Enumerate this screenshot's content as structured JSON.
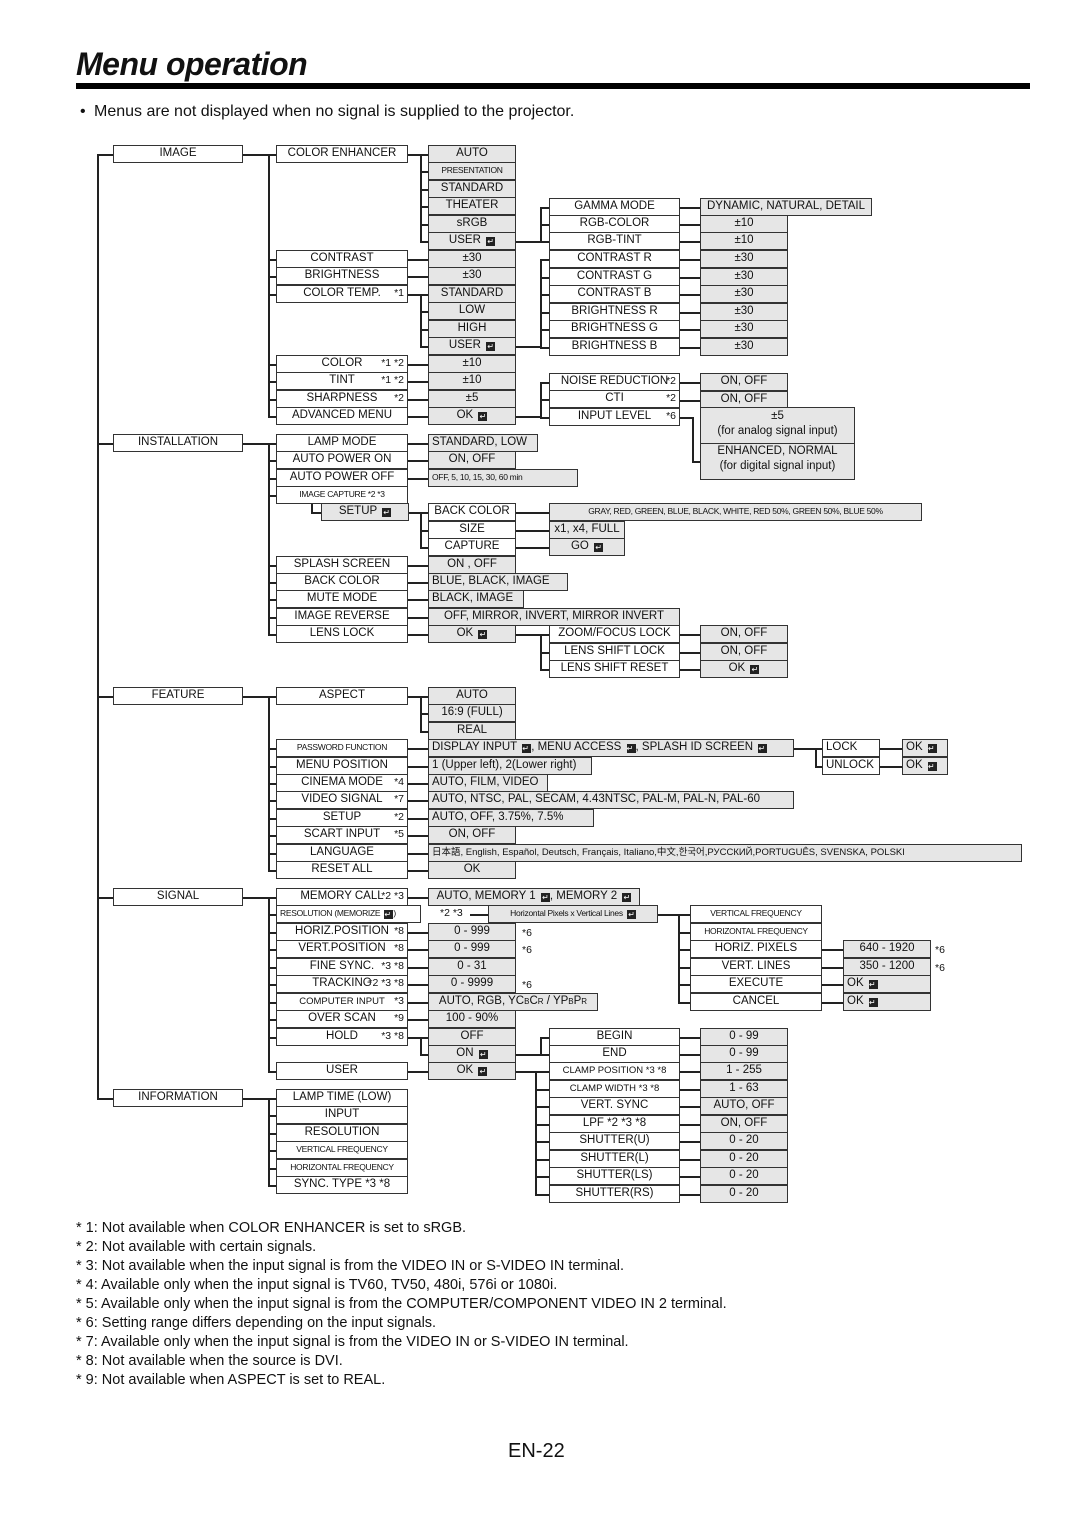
{
  "page": {
    "title": "Menu operation",
    "bullet": "Menus are not displayed when no signal is supplied to the projector.",
    "page_number": "EN-22"
  },
  "menu": {
    "top": [
      "IMAGE",
      "INSTALLATION",
      "FEATURE",
      "SIGNAL",
      "INFORMATION"
    ],
    "image": {
      "items": [
        "COLOR ENHANCER",
        "CONTRAST",
        "BRIGHTNESS",
        "COLOR TEMP.",
        "COLOR",
        "TINT",
        "SHARPNESS",
        "ADVANCED MENU"
      ],
      "notes": [
        "",
        "",
        "",
        "*1",
        "*1 *2",
        "*1 *2",
        "*2",
        ""
      ],
      "color_enhancer_options": [
        "AUTO",
        "PRESENTATION",
        "STANDARD",
        "THEATER",
        "sRGB",
        "USER"
      ],
      "contrast_value": "±30",
      "brightness_value": "±30",
      "color_temp_options": [
        "STANDARD",
        "LOW",
        "HIGH",
        "USER"
      ],
      "color_value": "±10",
      "tint_value": "±10",
      "sharpness_value": "±5",
      "advanced_value": "OK",
      "user_enhancer_items": [
        "GAMMA MODE",
        "RGB-COLOR",
        "RGB-TINT"
      ],
      "user_enhancer_values": [
        "DYNAMIC, NATURAL, DETAIL",
        "±10",
        "±10"
      ],
      "user_temp_items": [
        "CONTRAST R",
        "CONTRAST G",
        "CONTRAST B",
        "BRIGHTNESS R",
        "BRIGHTNESS G",
        "BRIGHTNESS B"
      ],
      "user_temp_values": [
        "±30",
        "±30",
        "±30",
        "±30",
        "±30",
        "±30"
      ],
      "advanced_items": [
        "NOISE REDUCTION",
        "CTI",
        "INPUT LEVEL"
      ],
      "advanced_notes": [
        "*2",
        "*2",
        "*6"
      ],
      "advanced_values": [
        "ON, OFF",
        "ON, OFF"
      ],
      "input_level_analog": [
        "±5",
        "(for analog signal input)"
      ],
      "input_level_digital": [
        "ENHANCED, NORMAL",
        "(for digital signal input)"
      ]
    },
    "installation": {
      "items": [
        "LAMP MODE",
        "AUTO POWER ON",
        "AUTO POWER OFF",
        "IMAGE CAPTURE  *2 *3",
        "SETUP",
        "SPLASH SCREEN",
        "BACK COLOR",
        "MUTE MODE",
        "IMAGE REVERSE",
        "LENS LOCK"
      ],
      "values": [
        "STANDARD, LOW",
        "ON, OFF",
        "OFF,  5,  10,  15,  30,  60 min"
      ],
      "setup_items": [
        "BACK COLOR",
        "SIZE",
        "CAPTURE"
      ],
      "setup_values": [
        "GRAY, RED, GREEN, BLUE, BLACK, WHITE, RED 50%, GREEN 50%, BLUE 50%",
        "x1, x4, FULL",
        "GO"
      ],
      "splash_value": "ON , OFF",
      "back_color_value": "BLUE, BLACK, IMAGE",
      "mute_value": "BLACK, IMAGE",
      "reverse_value": "OFF, MIRROR, INVERT, MIRROR INVERT",
      "lens_lock_value": "OK",
      "lens_items": [
        "ZOOM/FOCUS LOCK",
        "LENS SHIFT LOCK",
        "LENS SHIFT RESET"
      ],
      "lens_values": [
        "ON, OFF",
        "ON, OFF",
        "OK"
      ]
    },
    "feature": {
      "items": [
        "ASPECT",
        "PASSWORD FUNCTION",
        "MENU POSITION",
        "CINEMA MODE",
        "VIDEO SIGNAL",
        "SETUP",
        "SCART INPUT",
        "LANGUAGE",
        "RESET ALL"
      ],
      "notes": [
        "",
        "",
        "",
        "*4",
        "*7",
        "*2",
        "*5",
        "",
        ""
      ],
      "aspect_options": [
        "AUTO",
        "16:9 (FULL)",
        "REAL"
      ],
      "values": [
        "DISPLAY INPUT ↵, MENU ACCESS ↵, SPLASH ID SCREEN ↵",
        "1 (Upper left), 2(Lower right)",
        "AUTO, FILM, VIDEO",
        "AUTO, NTSC, PAL, SECAM, 4.43NTSC, PAL-M, PAL-N, PAL-60",
        "AUTO, OFF, 3.75%, 7.5%",
        "ON, OFF",
        "日本語, English, Español, Deutsch, Français, Italiano,中文,한국어,РУССКИЙ,PORTUGUÊS, SVENSKA, POLSKI",
        "OK"
      ],
      "lock_items": [
        "LOCK",
        "UNLOCK"
      ],
      "lock_values": [
        "OK",
        "OK"
      ]
    },
    "signal": {
      "items": [
        "MEMORY CALL",
        "RESOLUTION (MEMORIZE ↵)",
        "HORIZ.POSITION",
        "VERT.POSITION",
        "FINE SYNC.",
        "TRACKING",
        "COMPUTER INPUT",
        "OVER SCAN",
        "HOLD",
        "USER"
      ],
      "notes": [
        "*2 *3",
        "*2 *3",
        "*8",
        "*8",
        "*3 *8",
        "*2 *3 *8",
        "*3",
        "*9",
        "*3 *8",
        ""
      ],
      "values": [
        "AUTO, MEMORY 1 ↵, MEMORY 2 ↵",
        "Horizontal Pixels x Vertical Lines ↵",
        "0 - 999",
        "0 - 999",
        "0 - 31",
        "0 - 9999",
        "AUTO, RGB, YCBCR / YPBPR",
        "100 - 90%"
      ],
      "value_notes": [
        "",
        "",
        "*6",
        "*6",
        "",
        "*6",
        "",
        ""
      ],
      "hold_options": [
        "OFF",
        "ON"
      ],
      "user_value": "OK",
      "resolution_items": [
        "VERTICAL FREQUENCY",
        "HORIZONTAL FREQUENCY",
        "HORIZ. PIXELS",
        "VERT. LINES",
        "EXECUTE",
        "CANCEL"
      ],
      "resolution_values": [
        "640 - 1920",
        "350 - 1200",
        "OK",
        "OK"
      ],
      "resolution_value_notes": [
        "*6",
        "*6",
        "",
        ""
      ],
      "hold_items": [
        "BEGIN",
        "END"
      ],
      "hold_values": [
        "0 - 99",
        "0 - 99"
      ],
      "user_items": [
        "CLAMP POSITION *3 *8",
        "CLAMP WIDTH  *3 *8",
        "VERT. SYNC",
        "LPF   *2 *3 *8",
        "SHUTTER(U)",
        "SHUTTER(L)",
        "SHUTTER(LS)",
        "SHUTTER(RS)"
      ],
      "user_values": [
        "1 - 255",
        "1 - 63",
        "AUTO, OFF",
        "ON, OFF",
        "0 - 20",
        "0 - 20",
        "0 - 20",
        "0 - 20"
      ]
    },
    "information": {
      "items": [
        "LAMP TIME (LOW)",
        "INPUT",
        "RESOLUTION",
        "VERTICAL FREQUENCY",
        "HORIZONTAL FREQUENCY",
        "SYNC. TYPE *3 *8"
      ]
    }
  },
  "footnotes": [
    "* 1: Not available when COLOR ENHANCER is set to sRGB.",
    "* 2: Not available with certain signals.",
    "* 3: Not available when the input signal is from the VIDEO IN or S-VIDEO IN terminal.",
    "* 4: Available only when the input signal is TV60, TV50, 480i, 576i or 1080i.",
    "* 5: Available only when the input signal is from the COMPUTER/COMPONENT VIDEO IN 2 terminal.",
    "* 6: Setting range differs depending on the input signals.",
    "* 7: Available only when the input signal is from the VIDEO IN or S-VIDEO IN terminal.",
    "* 8: Not available when the source is DVI.",
    "* 9: Not available when ASPECT is set to REAL."
  ]
}
